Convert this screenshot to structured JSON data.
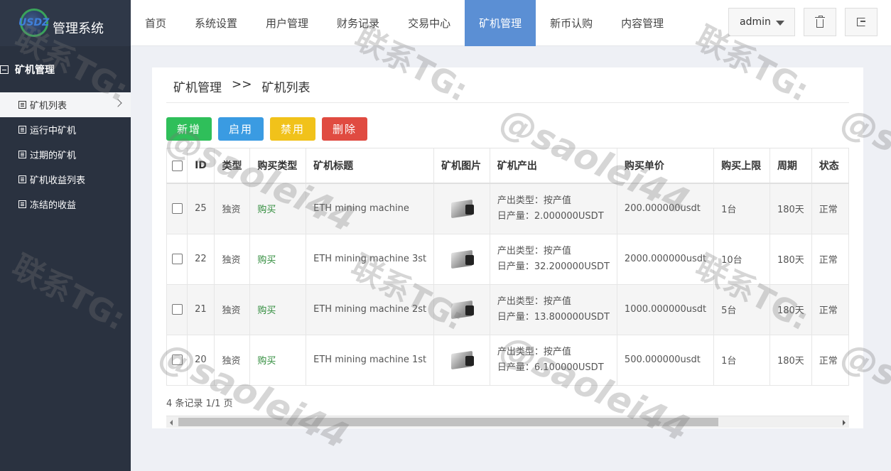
{
  "logo": {
    "text": "USDZ",
    "title": "管理系统"
  },
  "sidebar": {
    "group_label": "矿机管理",
    "items": [
      {
        "label": "矿机列表",
        "active": true
      },
      {
        "label": "运行中矿机",
        "active": false
      },
      {
        "label": "过期的矿机",
        "active": false
      },
      {
        "label": "矿机收益列表",
        "active": false
      },
      {
        "label": "冻结的收益",
        "active": false
      }
    ]
  },
  "topnav": {
    "items": [
      "首页",
      "系统设置",
      "用户管理",
      "财务记录",
      "交易中心",
      "矿机管理",
      "新币认购",
      "内容管理"
    ],
    "active": "矿机管理",
    "user": "admin"
  },
  "breadcrumb": {
    "parent": "矿机管理",
    "separator": ">>",
    "current": "矿机列表"
  },
  "actions": {
    "add": "新增",
    "enable": "启用",
    "disable": "禁用",
    "delete": "删除"
  },
  "table": {
    "headers": [
      "ID",
      "类型",
      "购买类型",
      "矿机标题",
      "矿机图片",
      "矿机产出",
      "购买单价",
      "购买上限",
      "周期",
      "状态"
    ],
    "rows": [
      {
        "id": "25",
        "type": "独资",
        "buy_type": "购买",
        "title": "ETH mining machine",
        "output_type": "产出类型：按产值",
        "daily": "日产量：2.000000USDT",
        "price": "200.000000usdt",
        "limit": "1台",
        "cycle": "180天",
        "status": "正常"
      },
      {
        "id": "22",
        "type": "独资",
        "buy_type": "购买",
        "title": "ETH mining machine 3st",
        "output_type": "产出类型：按产值",
        "daily": "日产量：32.200000USDT",
        "price": "2000.000000usdt",
        "limit": "10台",
        "cycle": "180天",
        "status": "正常"
      },
      {
        "id": "21",
        "type": "独资",
        "buy_type": "购买",
        "title": "ETH mining machine 2st",
        "output_type": "产出类型：按产值",
        "daily": "日产量：13.800000USDT",
        "price": "1000.000000usdt",
        "limit": "5台",
        "cycle": "180天",
        "status": "正常"
      },
      {
        "id": "20",
        "type": "独资",
        "buy_type": "购买",
        "title": "ETH mining machine 1st",
        "output_type": "产出类型：按产值",
        "daily": "日产量：6.100000USDT",
        "price": "500.000000usdt",
        "limit": "1台",
        "cycle": "180天",
        "status": "正常"
      }
    ]
  },
  "records": "4 条记录 1/1 页",
  "watermarks": {
    "tg": "联系TG:",
    "handle": "@saolei44"
  },
  "colors": {
    "sidebar": "#2a3240",
    "nav_active": "#5b8fd4",
    "add": "#2fbf5a",
    "enable": "#3a9be2",
    "disable": "#f1c21a",
    "delete": "#e04b41"
  }
}
